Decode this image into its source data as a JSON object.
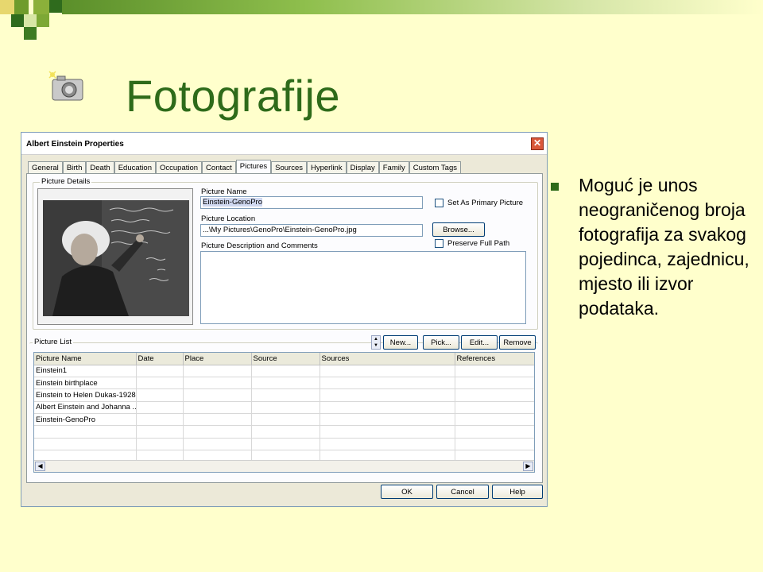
{
  "slide": {
    "title": "Fotografije",
    "bullet": "Moguć je unos neograničenog broja fotografija za svakog pojedinca, zajednicu, mjesto ili izvor podataka.",
    "colors": {
      "accent": "#2e6b1a",
      "background": "#ffffcc"
    }
  },
  "window": {
    "title": "Albert Einstein Properties",
    "close_glyph": "✕",
    "tabs": [
      "General",
      "Birth",
      "Death",
      "Education",
      "Occupation",
      "Contact",
      "Pictures",
      "Sources",
      "Hyperlink",
      "Display",
      "Family",
      "Custom Tags"
    ],
    "active_tab": "Pictures",
    "picture_details": {
      "group_label": "Picture Details",
      "picture_name_label": "Picture Name",
      "picture_name_value": "Einstein-GenoPro",
      "picture_location_label": "Picture Location",
      "picture_location_value": "...\\My Pictures\\GenoPro\\Einstein-GenoPro.jpg",
      "description_label": "Picture Description and Comments",
      "set_primary_label": "Set As Primary Picture",
      "browse_label": "Browse...",
      "preserve_path_label": "Preserve Full Path"
    },
    "picture_list": {
      "group_label": "Picture List",
      "buttons": {
        "new": "New...",
        "pick": "Pick...",
        "edit": "Edit...",
        "remove": "Remove"
      },
      "columns": [
        "Picture Name",
        "Date",
        "Place",
        "Source",
        "Sources",
        "References"
      ],
      "rows": [
        [
          "Einstein1",
          "",
          "",
          "",
          "",
          ""
        ],
        [
          "Einstein birthplace",
          "",
          "",
          "",
          "",
          ""
        ],
        [
          "Einstein to Helen Dukas-1928",
          "",
          "",
          "",
          "",
          ""
        ],
        [
          "Albert Einstein and Johanna ...",
          "",
          "",
          "",
          "",
          ""
        ],
        [
          "Einstein-GenoPro",
          "",
          "",
          "",
          "",
          ""
        ],
        [
          "",
          "",
          "",
          "",
          "",
          ""
        ],
        [
          "",
          "",
          "",
          "",
          "",
          ""
        ],
        [
          "",
          "",
          "",
          "",
          "",
          ""
        ]
      ]
    },
    "footer_buttons": {
      "ok": "OK",
      "cancel": "Cancel",
      "help": "Help"
    }
  }
}
